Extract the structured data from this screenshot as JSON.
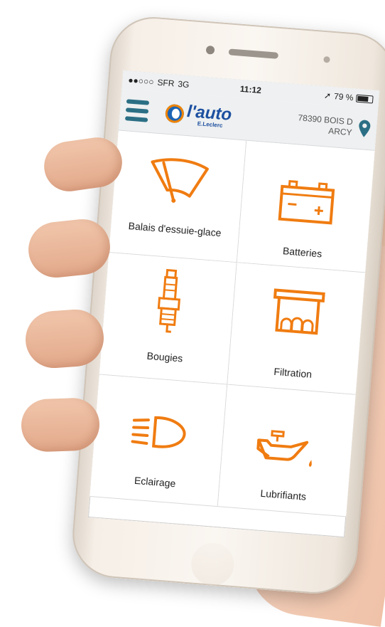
{
  "status_bar": {
    "signal": "●●○○○",
    "carrier": "SFR",
    "network": "3G",
    "time": "11:12",
    "location_arrow": "➚",
    "battery": "79 %"
  },
  "header": {
    "logo_main": "l'auto",
    "logo_sub": "E.Leclerc",
    "location_line1": "78390 BOIS D",
    "location_line2": "ARCY"
  },
  "categories": [
    {
      "label": "Balais d'essuie-glace",
      "icon": "wiper-icon"
    },
    {
      "label": "Batteries",
      "icon": "battery-icon"
    },
    {
      "label": "Bougies",
      "icon": "spark-plug-icon"
    },
    {
      "label": "Filtration",
      "icon": "filter-icon"
    },
    {
      "label": "Eclairage",
      "icon": "headlight-icon"
    },
    {
      "label": "Lubrifiants",
      "icon": "oil-can-icon"
    }
  ],
  "colors": {
    "accent": "#f07c11",
    "header_bg": "#eef0f1",
    "brand_blue": "#1c4fa0",
    "menu_teal": "#2b6f85"
  }
}
